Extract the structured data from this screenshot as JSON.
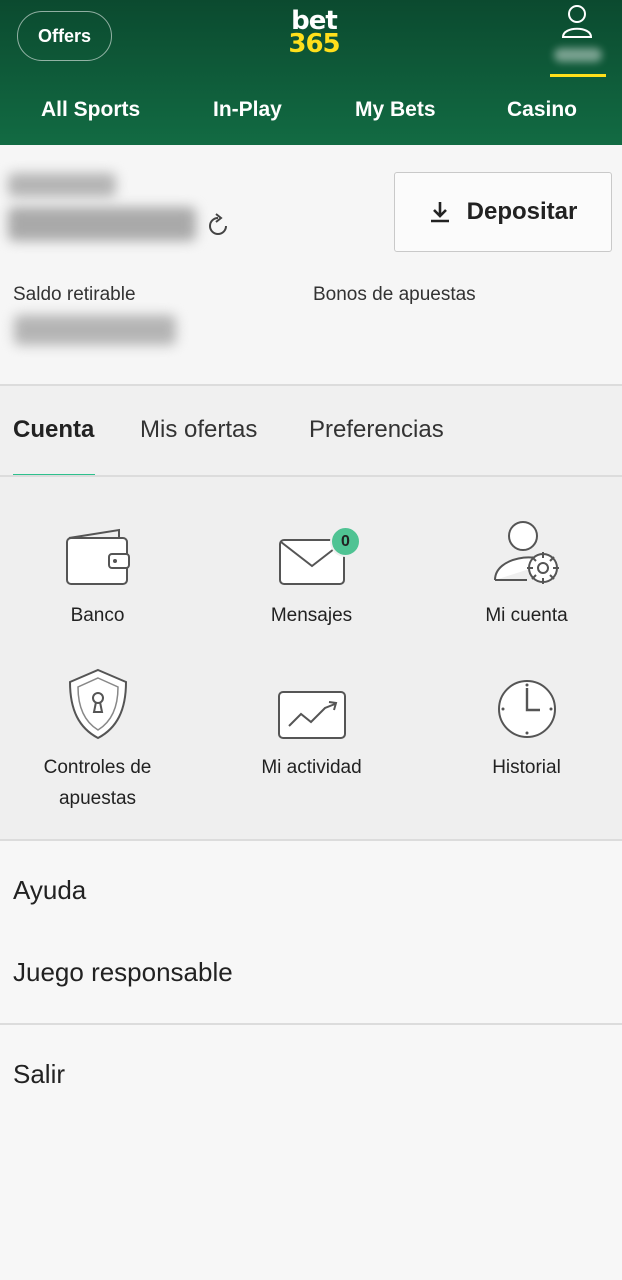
{
  "header": {
    "offers_label": "Offers",
    "logo_line1": "bet",
    "logo_line2": "365",
    "accent_color": "#ffdf1b",
    "nav": [
      {
        "label": "All Sports"
      },
      {
        "label": "In-Play"
      },
      {
        "label": "My Bets"
      },
      {
        "label": "Casino"
      }
    ]
  },
  "balance": {
    "deposit_label": "Depositar",
    "withdrawable_label": "Saldo retirable",
    "bonus_label": "Bonos de apuestas"
  },
  "tabs": [
    {
      "label": "Cuenta",
      "active": true
    },
    {
      "label": "Mis ofertas",
      "active": false
    },
    {
      "label": "Preferencias",
      "active": false
    }
  ],
  "grid": [
    {
      "label": "Banco",
      "icon": "wallet-icon"
    },
    {
      "label": "Mensajes",
      "icon": "envelope-icon",
      "badge": "0"
    },
    {
      "label": "Mi cuenta",
      "icon": "user-settings-icon"
    },
    {
      "label": "Controles de apuestas",
      "icon": "shield-lock-icon"
    },
    {
      "label": "Mi actividad",
      "icon": "activity-chart-icon"
    },
    {
      "label": "Historial",
      "icon": "clock-icon"
    }
  ],
  "menu": {
    "help": "Ayuda",
    "responsible": "Juego responsable",
    "logout": "Salir"
  }
}
